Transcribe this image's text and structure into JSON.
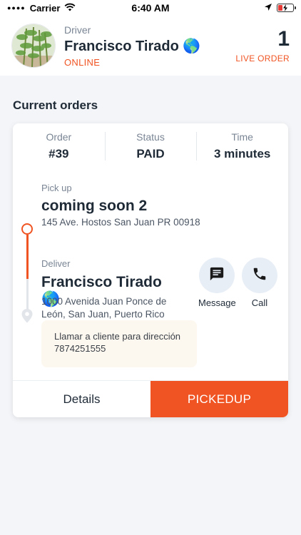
{
  "status_bar": {
    "carrier": "Carrier",
    "time": "6:40 AM"
  },
  "header": {
    "driver_label": "Driver",
    "driver_name": "Francisco Tirado 🌎",
    "driver_status": "ONLINE",
    "live_count": "1",
    "live_label": "LIVE ORDER"
  },
  "section_title": "Current orders",
  "order": {
    "order_label": "Order",
    "order_value": "#39",
    "status_label": "Status",
    "status_value": "PAID",
    "time_label": "Time",
    "time_value": "3 minutes",
    "pickup": {
      "label": "Pick up",
      "name": "coming soon 2",
      "address": "145 Ave. Hostos San Juan PR 00918"
    },
    "deliver": {
      "label": "Deliver",
      "name": "Francisco Tirado 🌎",
      "address": "1000 Avenida Juan Ponce de León, San Juan, Puerto Rico"
    },
    "actions": {
      "message_label": "Message",
      "call_label": "Call"
    },
    "note": "Llamar a cliente para dirección 7874251555",
    "buttons": {
      "details": "Details",
      "pickedup": "PICKEDUP"
    }
  },
  "colors": {
    "accent": "#f05423",
    "action_bg": "#e8eef6",
    "note_bg": "#fdf8ef"
  },
  "icons": [
    "wifi-icon",
    "location-arrow-icon",
    "battery-charging-icon",
    "message-icon",
    "phone-icon",
    "map-pin-icon"
  ]
}
